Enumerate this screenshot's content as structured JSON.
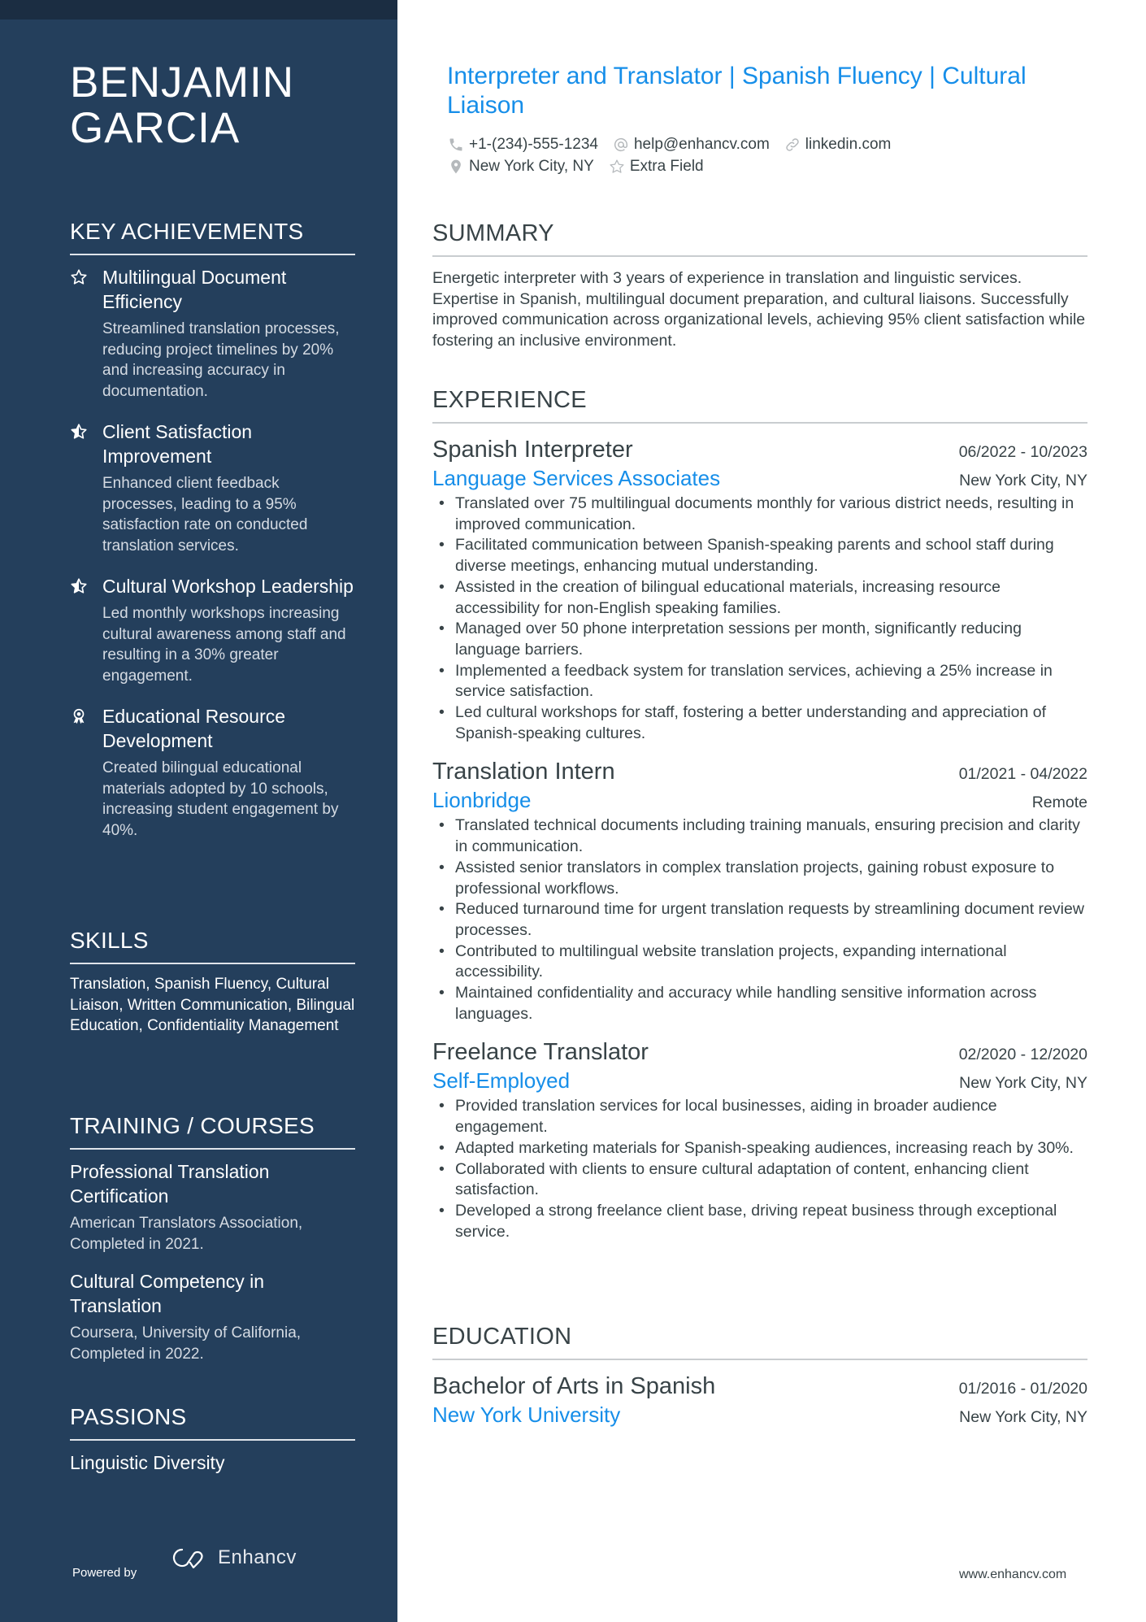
{
  "sidebar": {
    "name_line1": "BENJAMIN",
    "name_line2": "GARCIA",
    "achievements_title": "KEY ACHIEVEMENTS",
    "achievements": [
      {
        "icon": "star-outline-icon",
        "title": "Multilingual Document Efficiency",
        "desc": "Streamlined translation processes, reducing project timelines by 20% and increasing accuracy in documentation."
      },
      {
        "icon": "star-half-icon",
        "title": "Client Satisfaction Improvement",
        "desc": "Enhanced client feedback processes, leading to a 95% satisfaction rate on conducted translation services."
      },
      {
        "icon": "star-half-icon",
        "title": "Cultural Workshop Leadership",
        "desc": "Led monthly workshops increasing cultural awareness among staff and resulting in a 30% greater engagement."
      },
      {
        "icon": "award-medal-icon",
        "title": "Educational Resource Development",
        "desc": "Created bilingual educational materials adopted by 10 schools, increasing student engagement by 40%."
      }
    ],
    "skills_title": "SKILLS",
    "skills_text": "Translation, Spanish Fluency, Cultural Liaison, Written Communication, Bilingual Education, Confidentiality Management",
    "training_title": "TRAINING / COURSES",
    "courses": [
      {
        "title": "Professional Translation Certification",
        "desc": "American Translators Association, Completed in 2021."
      },
      {
        "title": "Cultural Competency in Translation",
        "desc": "Coursera, University of California, Completed in 2022."
      }
    ],
    "passions_title": "PASSIONS",
    "passions": [
      "Linguistic Diversity"
    ],
    "powered_by": "Powered by",
    "brand": "Enhancv"
  },
  "header": {
    "headline": "Interpreter and Translator | Spanish Fluency | Cultural Liaison",
    "phone": "+1-(234)-555-1234",
    "email": "help@enhancv.com",
    "link": "linkedin.com",
    "location": "New York City, NY",
    "extra": "Extra Field"
  },
  "summary": {
    "title": "SUMMARY",
    "text": "Energetic interpreter with 3 years of experience in translation and linguistic services. Expertise in Spanish, multilingual document preparation, and cultural liaisons. Successfully improved communication across organizational levels, achieving 95% client satisfaction while fostering an inclusive environment."
  },
  "experience": {
    "title": "EXPERIENCE",
    "jobs": [
      {
        "role": "Spanish Interpreter",
        "dates": "06/2022 - 10/2023",
        "company": "Language Services Associates",
        "location": "New York City, NY",
        "bullets": [
          "Translated over 75 multilingual documents monthly for various district needs, resulting in improved communication.",
          "Facilitated communication between Spanish-speaking parents and school staff during diverse meetings, enhancing mutual understanding.",
          "Assisted in the creation of bilingual educational materials, increasing resource accessibility for non-English speaking families.",
          "Managed over 50 phone interpretation sessions per month, significantly reducing language barriers.",
          "Implemented a feedback system for translation services, achieving a 25% increase in service satisfaction.",
          "Led cultural workshops for staff, fostering a better understanding and appreciation of Spanish-speaking cultures."
        ]
      },
      {
        "role": "Translation Intern",
        "dates": "01/2021 - 04/2022",
        "company": "Lionbridge",
        "location": "Remote",
        "bullets": [
          "Translated technical documents including training manuals, ensuring precision and clarity in communication.",
          "Assisted senior translators in complex translation projects, gaining robust exposure to professional workflows.",
          "Reduced turnaround time for urgent translation requests by streamlining document review processes.",
          "Contributed to multilingual website translation projects, expanding international accessibility.",
          "Maintained confidentiality and accuracy while handling sensitive information across languages."
        ]
      },
      {
        "role": "Freelance Translator",
        "dates": "02/2020 - 12/2020",
        "company": "Self-Employed",
        "location": "New York City, NY",
        "bullets": [
          "Provided translation services for local businesses, aiding in broader audience engagement.",
          "Adapted marketing materials for Spanish-speaking audiences, increasing reach by 30%.",
          "Collaborated with clients to ensure cultural adaptation of content, enhancing client satisfaction.",
          "Developed a strong freelance client base, driving repeat business through exceptional service."
        ]
      }
    ]
  },
  "education": {
    "title": "EDUCATION",
    "degree": "Bachelor of Arts in Spanish",
    "dates": "01/2016 - 01/2020",
    "school": "New York University",
    "location": "New York City, NY"
  },
  "footer": {
    "site": "www.enhancv.com"
  },
  "colors": {
    "sidebar": "#243f5c",
    "accent": "#168ee9",
    "text": "#384347"
  }
}
